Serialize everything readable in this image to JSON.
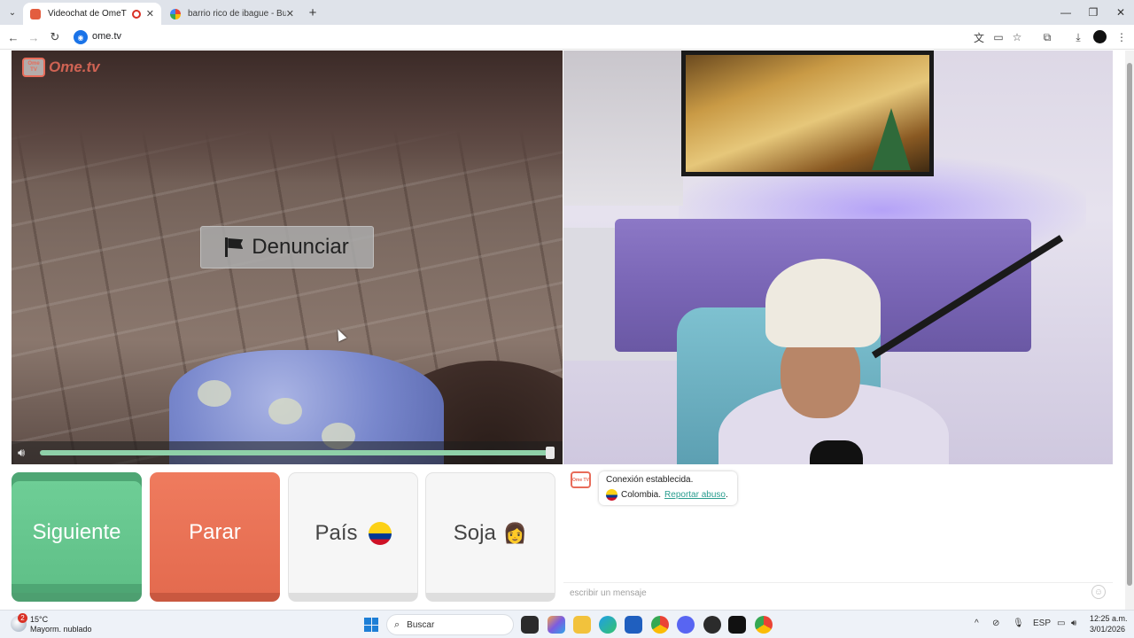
{
  "browser": {
    "tabs": [
      {
        "title": "Videochat de OmeTV: una"
      },
      {
        "title": "barrio rico de ibague - Buscar c"
      }
    ],
    "url": "ome.tv"
  },
  "video": {
    "logo_word": "Ome.tv",
    "logo_tv": "Ome TV",
    "report_label": "Denunciar",
    "volume_level": 0.97
  },
  "controls": {
    "next_label": "Siguiente",
    "stop_label": "Parar",
    "country_label": "País",
    "gender_label": "Soja"
  },
  "chat": {
    "status": "Conexión establecida.",
    "country": "Colombia",
    "separator": " .",
    "report_link": "Reportar abuso",
    "report_suffix": ".",
    "input_placeholder": "escribir un mensaje"
  },
  "taskbar": {
    "weather_temp": "15°C",
    "weather_desc": "Mayorm. nublado",
    "weather_badge": "2",
    "search_label": "Buscar",
    "language": "ESP",
    "time": "12:25 a.m.",
    "date": "3/01/2026"
  },
  "colors": {
    "next": "#6fcf97",
    "stop": "#e46b4f",
    "brand": "#e86c5a",
    "link": "#2a9d8f"
  }
}
